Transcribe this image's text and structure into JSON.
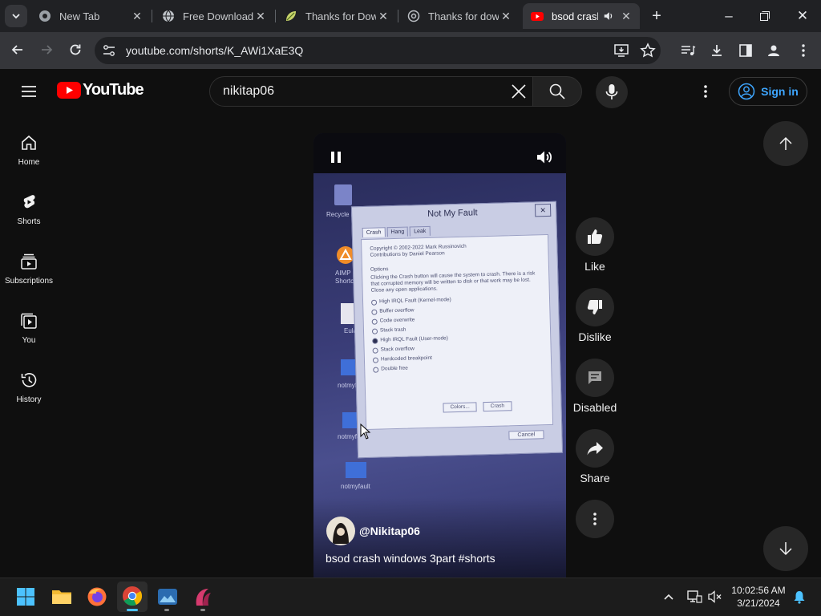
{
  "browser": {
    "tabs": [
      {
        "title": "New Tab",
        "icon": "chrome-icon",
        "active": false
      },
      {
        "title": "Free Download",
        "icon": "globe-icon",
        "active": false
      },
      {
        "title": "Thanks for Dow",
        "icon": "leaf-icon",
        "active": false
      },
      {
        "title": "Thanks for dow",
        "icon": "at-sign-icon",
        "active": false
      },
      {
        "title": "bsod crash",
        "icon": "youtube-icon",
        "active": true
      }
    ],
    "url": "youtube.com/shorts/K_AWi1XaE3Q"
  },
  "youtube": {
    "logo_text": "YouTube",
    "search_value": "nikitap06",
    "sign_in_label": "Sign in",
    "brand_color": "#ff0000",
    "link_color": "#3ea6ff",
    "sidebar": [
      {
        "label": "Home",
        "icon": "home-icon"
      },
      {
        "label": "Shorts",
        "icon": "shorts-icon"
      },
      {
        "label": "Subscriptions",
        "icon": "subscriptions-icon"
      },
      {
        "label": "You",
        "icon": "you-icon"
      },
      {
        "label": "History",
        "icon": "history-icon"
      }
    ],
    "short": {
      "channel": "@Nikitap06",
      "title": "bsod crash windows 3part #shorts",
      "actions": [
        {
          "label": "Like",
          "icon": "thumbs-up-icon"
        },
        {
          "label": "Dislike",
          "icon": "thumbs-down-icon"
        },
        {
          "label": "Disabled",
          "icon": "comment-icon"
        },
        {
          "label": "Share",
          "icon": "share-icon"
        }
      ]
    },
    "video_content": {
      "window_title": "Not My Fault",
      "tabs": [
        "Crash",
        "Hang",
        "Leak"
      ],
      "copyright": "Copyright © 2002-2022 Mark Russinovich",
      "contributions": "Contributions by Daniel Pearson",
      "options_label": "Options",
      "warning": "Clicking the Crash button will cause the system to crash. There is a risk that corrupted memory will be written to disk or that work may be lost. Close any open applications.",
      "options": [
        "High IRQL Fault (Kernel-mode)",
        "Buffer overflow",
        "Code overwrite",
        "Stack trash",
        "High IRQL Fault (User-mode)",
        "Stack overflow",
        "Hardcoded breakpoint",
        "Double free"
      ],
      "selected_option": 4,
      "buttons": [
        "Colors...",
        "Crash",
        "Cancel"
      ],
      "desktop_icons": [
        "Recycle B",
        "AIMP Shortcu",
        "Eula",
        "notmyfa",
        "notmyfa",
        "notmyfault"
      ]
    }
  },
  "taskbar": {
    "apps": [
      "start-icon",
      "file-explorer-icon",
      "firefox-icon",
      "chrome-icon",
      "photos-icon",
      "app-icon"
    ],
    "time": "10:02:56 AM",
    "date": "3/21/2024"
  }
}
